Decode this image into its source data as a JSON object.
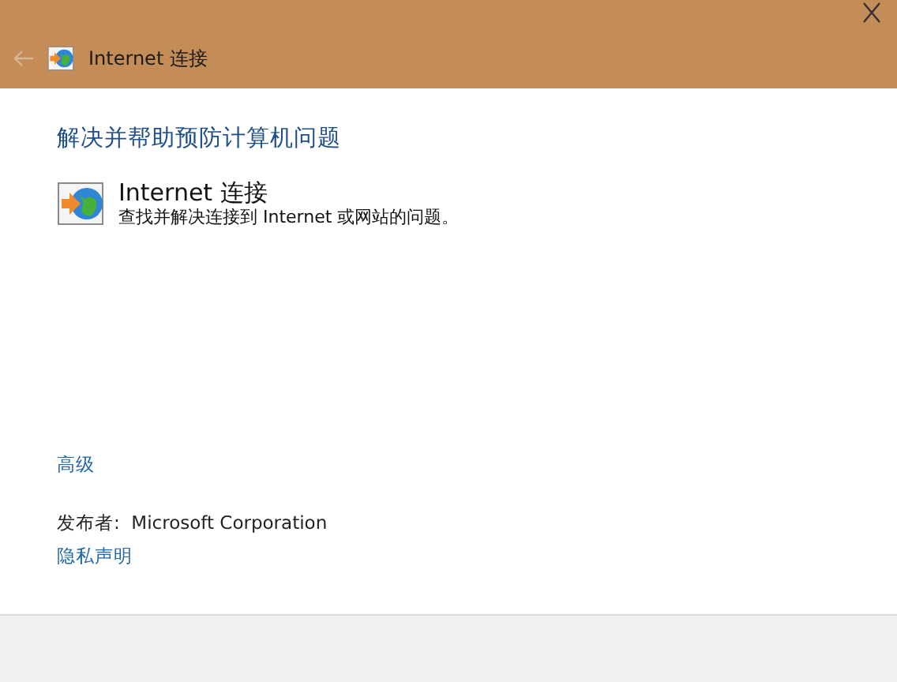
{
  "window": {
    "title": "Internet 连接"
  },
  "back_button": {
    "disabled": true
  },
  "heading": "解决并帮助预防计算机问题",
  "troubleshooter": {
    "title": "Internet 连接",
    "description": "查找并解决连接到 Internet 或网站的问题。"
  },
  "advanced_link": "高级",
  "publisher": "发布者:  Microsoft Corporation",
  "privacy_link": "隐私声明"
}
